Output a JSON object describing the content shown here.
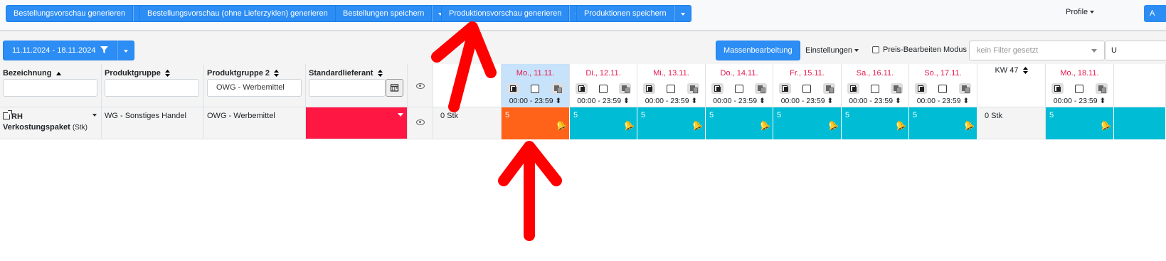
{
  "topbar": {
    "buttons": [
      {
        "label": "Bestellungsvorschau generieren"
      },
      {
        "label": "Bestellungsvorschau (ohne Lieferzyklen) generieren"
      },
      {
        "label": "Bestellungen speichern"
      },
      {
        "label": "Produktionsvorschau generieren"
      },
      {
        "label": "Produktionen speichern"
      }
    ],
    "profile_label": "Profile",
    "admin_label": "A"
  },
  "toolbar": {
    "date_range": "11.11.2024 - 18.11.2024",
    "mass_edit_label": "Massenbearbeitung",
    "settings_label": "Einstellungen",
    "price_mode_label": "Preis-Bearbeiten Modus",
    "filter_placeholder": "kein Filter gesetzt",
    "extra_label": "U"
  },
  "columns": {
    "bezeichnung": "Bezeichnung",
    "produktgruppe": "Produktgruppe",
    "produktgruppe2": "Produktgruppe 2",
    "standardlieferant": "Standardlieferant",
    "produktgruppe2_filter_value": "OWG - Werbemittel",
    "kw_label": "KW 47"
  },
  "days": [
    {
      "label": "Mo., 11.11.",
      "time": "00:00 - 23:59"
    },
    {
      "label": "Di., 12.11.",
      "time": "00:00 - 23:59"
    },
    {
      "label": "Mi., 13.11.",
      "time": "00:00 - 23:59"
    },
    {
      "label": "Do., 14.11.",
      "time": "00:00 - 23:59"
    },
    {
      "label": "Fr., 15.11.",
      "time": "00:00 - 23:59"
    },
    {
      "label": "Sa., 16.11.",
      "time": "00:00 - 23:59"
    },
    {
      "label": "So., 17.11.",
      "time": "00:00 - 23:59"
    },
    {
      "label": "Mo., 18.11.",
      "time": "00:00 - 23:59"
    }
  ],
  "row": {
    "name_line1": "RH",
    "name_line2": "Verkostungspaket",
    "unit": "(Stk)",
    "produktgruppe": "WG - Sonstiges Handel",
    "produktgruppe2": "OWG - Werbemittel",
    "stock_before": "0 Stk",
    "day_values": [
      "5",
      "5",
      "5",
      "5",
      "5",
      "5",
      "5",
      "5"
    ],
    "kw_value": "0 Stk"
  },
  "colors": {
    "primary": "#2c8df4",
    "day_cell": "#00bcd4",
    "day_cell_selected": "#ff6319",
    "supplier_missing": "#ff1744",
    "weekday_text": "#e9164a",
    "annotation_arrow": "#ff0000"
  }
}
